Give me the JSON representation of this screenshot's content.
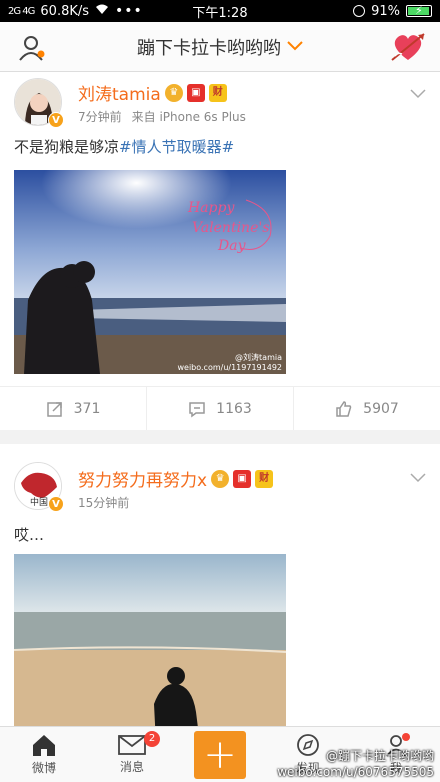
{
  "statusbar": {
    "signal": "2G 4G",
    "speed": "60.8K/s",
    "time": "下午1:28",
    "battery": "91%",
    "battery_level": 0.91
  },
  "navbar": {
    "title": "蹦下卡拉卡哟哟哟"
  },
  "posts": [
    {
      "username": "刘涛tamia",
      "time": "7分钟前",
      "source": "来自 iPhone 6s Plus",
      "text": "不是狗粮是够凉",
      "hashtag": "#情人节取暖器#",
      "image_caption": "Happy Valentine's Day",
      "image_watermark_name": "@刘涛tamia",
      "image_watermark_url": "weibo.com/u/1197191492",
      "reposts": "371",
      "comments": "1163",
      "likes": "5907"
    },
    {
      "username": "努力努力再努力x",
      "time": "15分钟前",
      "text": "哎…",
      "avatar_text": "中国"
    }
  ],
  "tabbar": {
    "home": "微博",
    "messages": "消息",
    "messages_badge": "2",
    "discover": "发现",
    "me": "我"
  },
  "watermark": {
    "line1": "@蹦下卡拉卡哟哟哟",
    "line2": "weibo.com/u/6076575505"
  },
  "colors": {
    "accent": "#ff8200",
    "username": "#f46c1c",
    "link": "#3a73b5"
  }
}
